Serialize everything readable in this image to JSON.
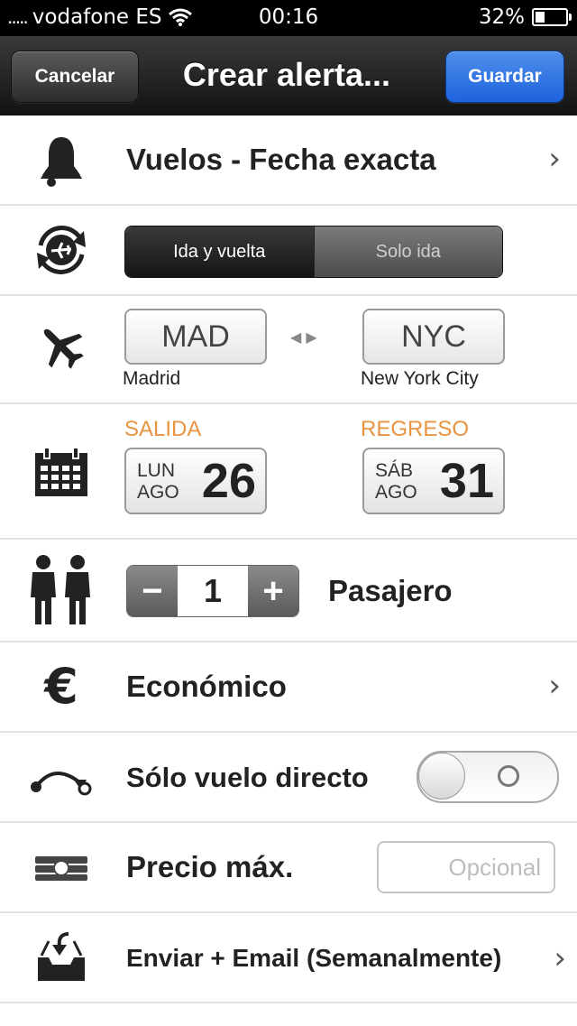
{
  "status_bar": {
    "carrier": "vodafone ES",
    "time": "00:16",
    "battery_text": "32%",
    "battery_level": 0.32,
    "signal_dots": "....."
  },
  "nav": {
    "cancel_label": "Cancelar",
    "title": "Crear alerta...",
    "save_label": "Guardar",
    "save_color": "#1e62dd"
  },
  "alert_type": {
    "icon": "bell-icon",
    "label": "Vuelos - Fecha exacta"
  },
  "trip_type": {
    "icon": "round-trip-plane-icon",
    "options": [
      "Ida y vuelta",
      "Solo ida"
    ],
    "selected": "Ida y vuelta"
  },
  "route": {
    "icon": "plane-icon",
    "origin_code": "MAD",
    "origin_city": "Madrid",
    "destination_code": "NYC",
    "destination_city": "New York City"
  },
  "dates": {
    "icon": "calendar-icon",
    "departure": {
      "label": "SALIDA",
      "weekday": "LUN",
      "month": "AGO",
      "day": "26"
    },
    "return": {
      "label": "REGRESO",
      "weekday": "SÁB",
      "month": "AGO",
      "day": "31"
    },
    "label_color": "#e89440"
  },
  "passengers": {
    "icon": "people-icon",
    "minus_label": "−",
    "plus_label": "+",
    "count": "1",
    "label": "Pasajero"
  },
  "cabin": {
    "icon": "euro-icon",
    "icon_glyph": "€",
    "label": "Económico"
  },
  "direct": {
    "icon": "direct-route-icon",
    "label": "Sólo vuelo directo",
    "enabled": false
  },
  "max_price": {
    "icon": "money-icon",
    "label": "Precio máx.",
    "placeholder": "Opcional",
    "value": ""
  },
  "notify": {
    "icon": "inbox-download-icon",
    "label": "Enviar + Email (Semanalmente)"
  }
}
